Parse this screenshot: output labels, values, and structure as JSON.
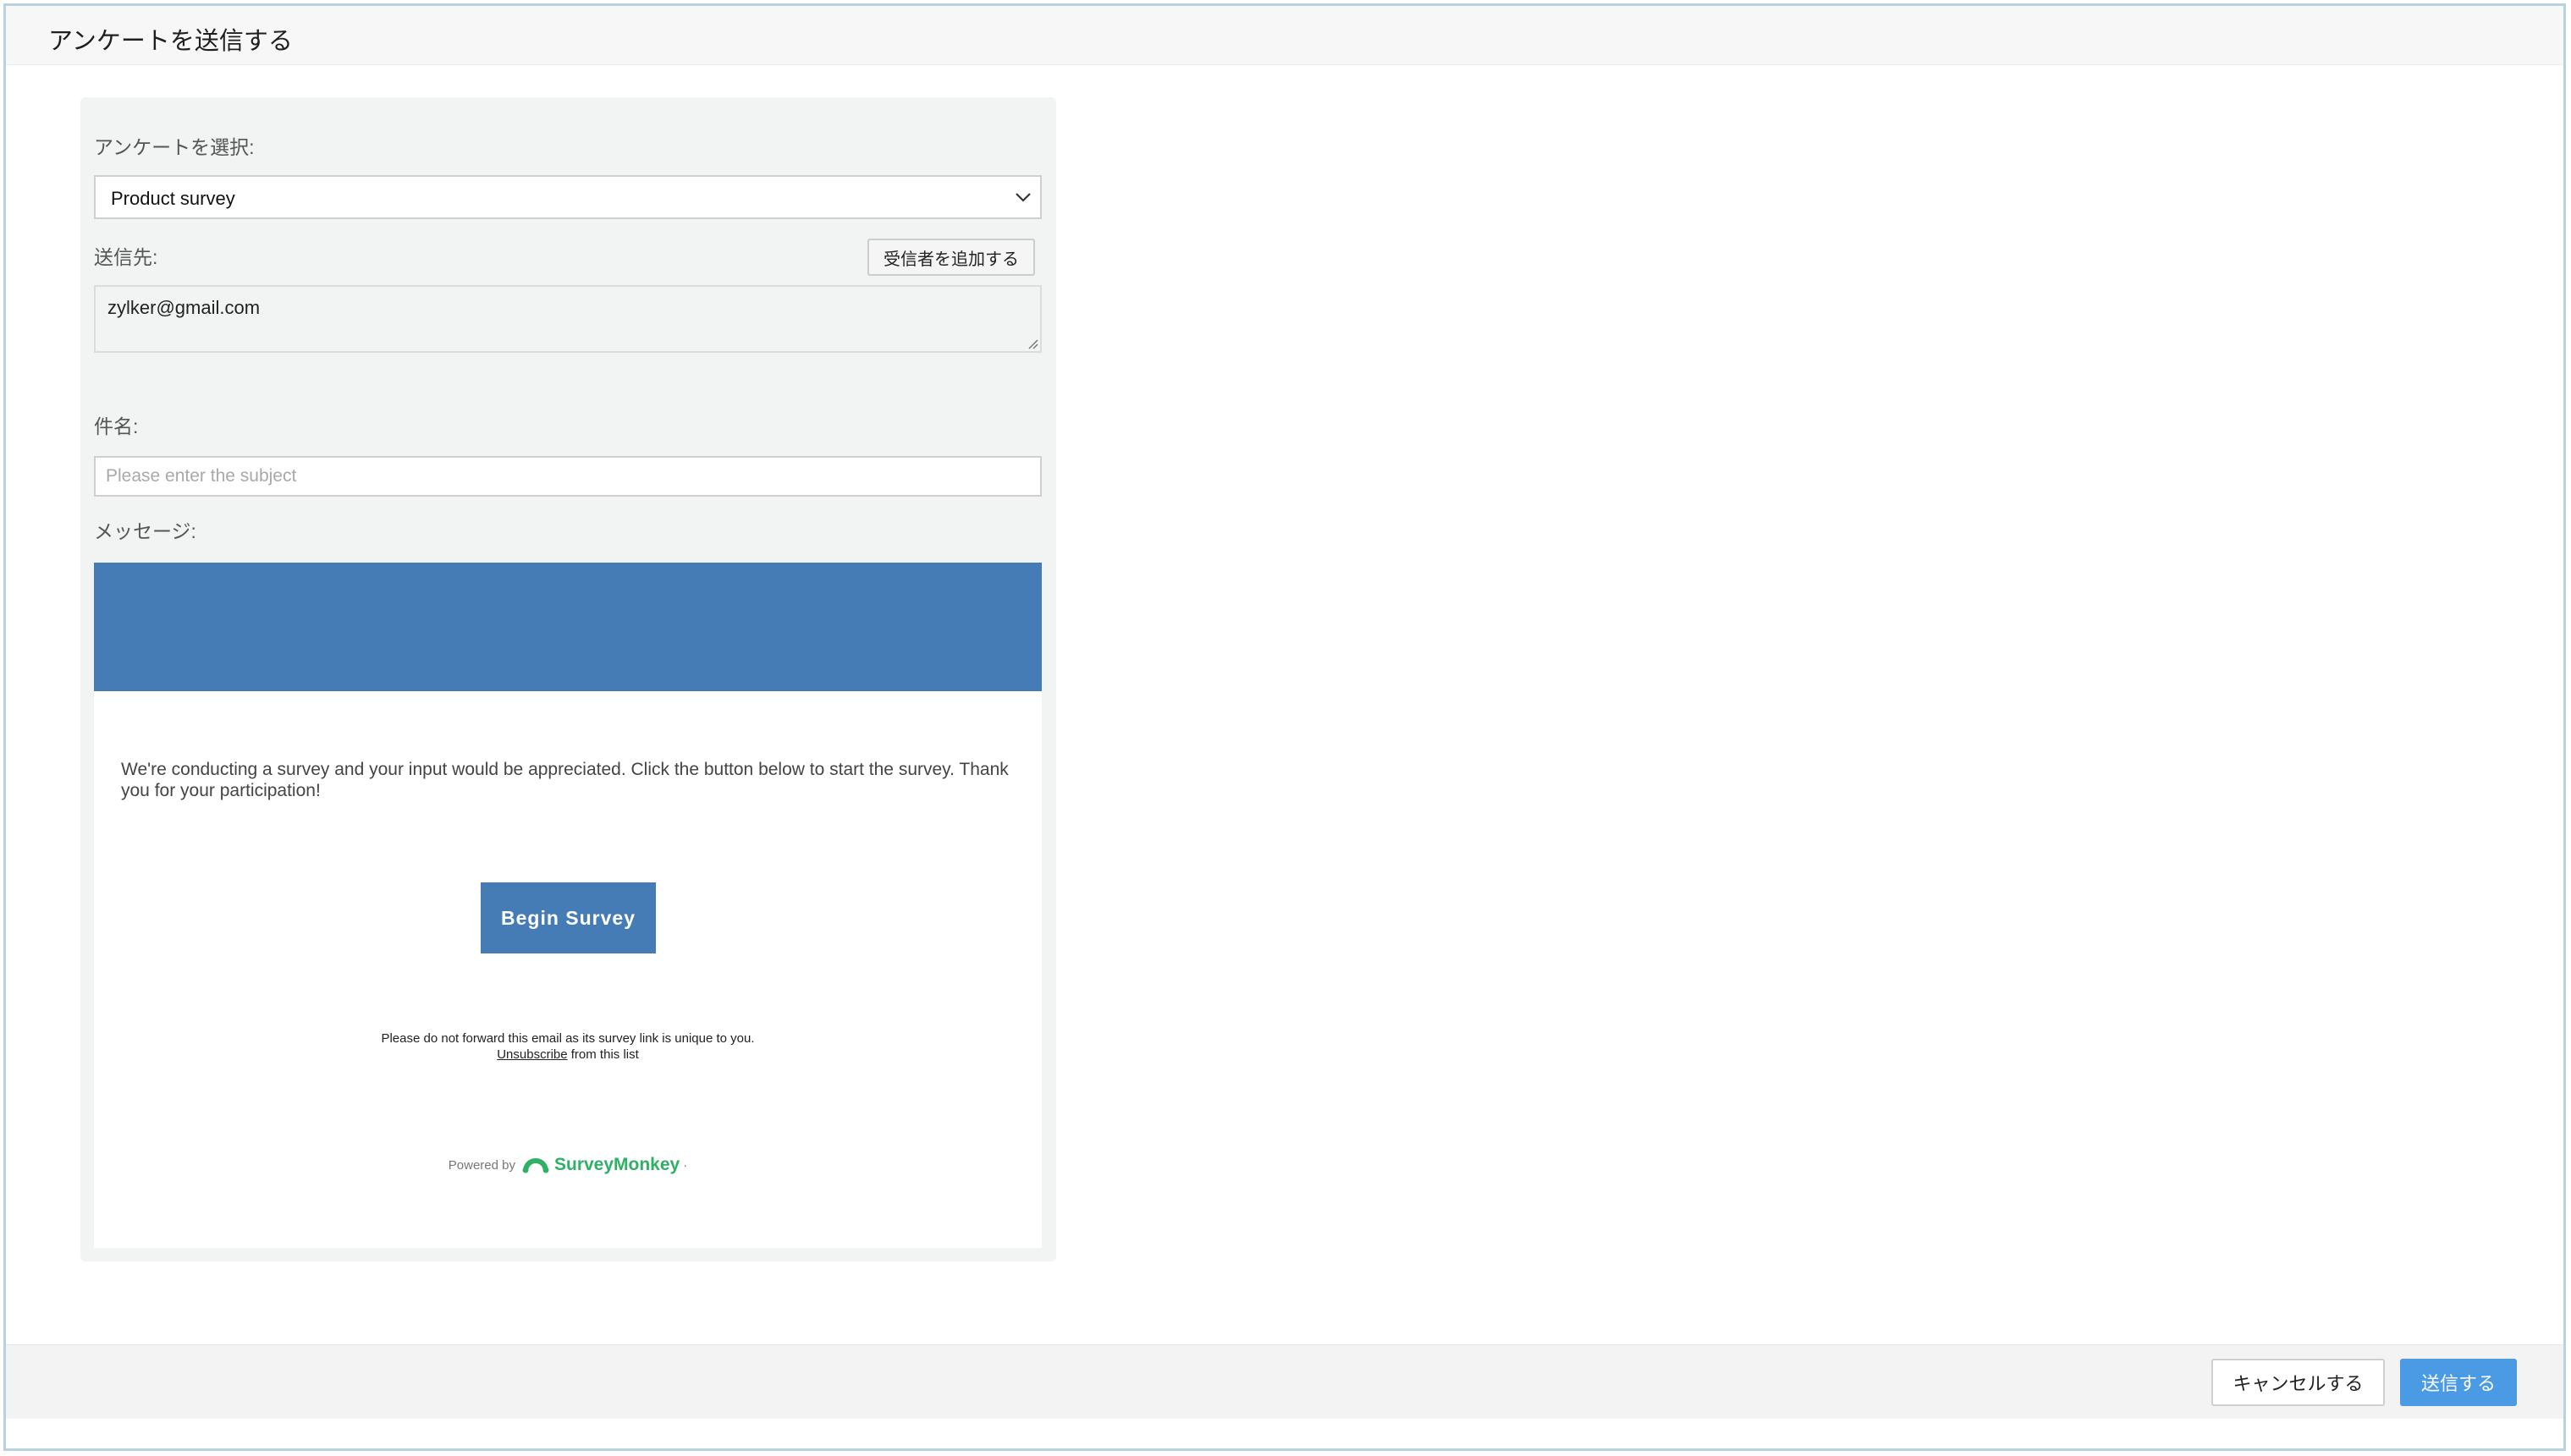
{
  "header": {
    "title": "アンケートを送信する"
  },
  "form": {
    "survey_label": "アンケートを選択:",
    "survey_selected": "Product survey",
    "to_label": "送信先:",
    "add_recipient_label": "受信者を追加する",
    "to_value": "zylker@gmail.com",
    "subject_label": "件名:",
    "subject_placeholder": "Please enter the subject",
    "subject_value": "",
    "message_label": "メッセージ:"
  },
  "email": {
    "banner_color": "#457cb5",
    "body": "We're conducting a survey and your input would be appreciated. Click the button below to start the survey. Thank you for your participation!",
    "button_label": "Begin Survey",
    "forward_note": "Please do not forward this email as its survey link is unique to you.",
    "unsubscribe_link": "Unsubscribe",
    "unsubscribe_suffix": " from this list",
    "powered_by": "Powered by",
    "brand": "SurveyMonkey",
    "brand_mark": "·",
    "brand_color": "#2fb065"
  },
  "footer": {
    "cancel_label": "キャンセルする",
    "send_label": "送信する",
    "send_color": "#4a9ae4"
  },
  "icons": {
    "select_caret": "chevron-down-icon",
    "resize": "resize-grip-icon",
    "logo": "surveymonkey-logo-icon"
  }
}
